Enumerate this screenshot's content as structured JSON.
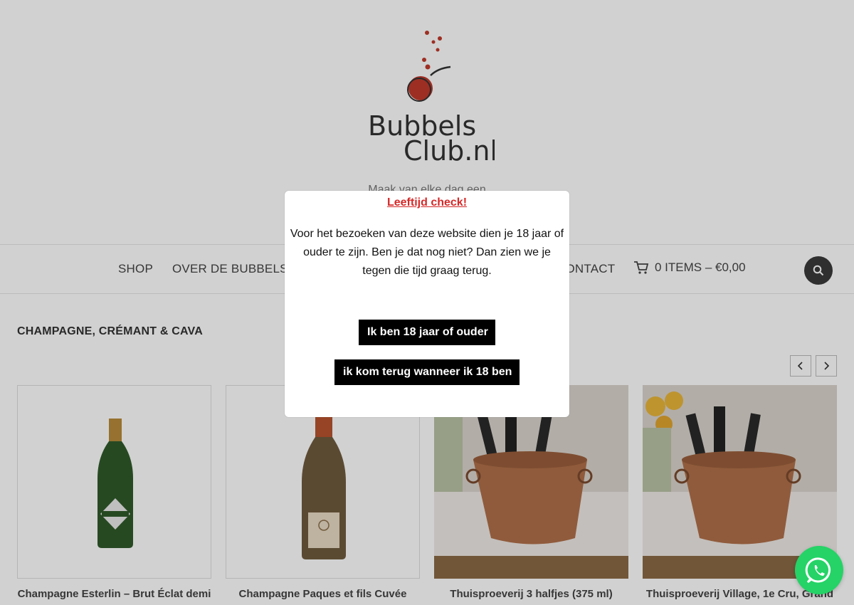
{
  "header": {
    "logo_text_line1": "Bubbels",
    "logo_text_line2": "Club.nl",
    "tagline": "Maak van elke dag een"
  },
  "nav": {
    "items": [
      {
        "label": "SHOP"
      },
      {
        "label": "OVER DE BUBBELSCLUB"
      },
      {
        "label": "CONTACT"
      }
    ],
    "cart_label": "0 ITEMS – €0,00",
    "cart_icon": "cart-icon",
    "search_icon": "search-icon"
  },
  "section": {
    "title": "CHAMPAGNE, CRÉMANT & CAVA"
  },
  "products": [
    {
      "name": "Champagne Esterlin – Brut Éclat demi"
    },
    {
      "name": "Champagne Paques et fils Cuvée"
    },
    {
      "name": "Thuisproeverij 3 halfjes (375 ml)"
    },
    {
      "name": "Thuisproeverij Village, 1e Cru, Grand"
    }
  ],
  "modal": {
    "title": "Leeftijd check!",
    "text": "Voor het bezoeken van deze website dien je 18 jaar of ouder te zijn. Ben je dat nog niet? Dan zien we je tegen die tijd graag terug.",
    "confirm_label": "Ik ben 18 jaar of ouder",
    "decline_label": "ik kom terug wanneer ik 18 ben"
  },
  "colors": {
    "accent": "#c0392b",
    "modal_title": "#d62828",
    "button_bg": "#000000",
    "whatsapp": "#25d366"
  }
}
